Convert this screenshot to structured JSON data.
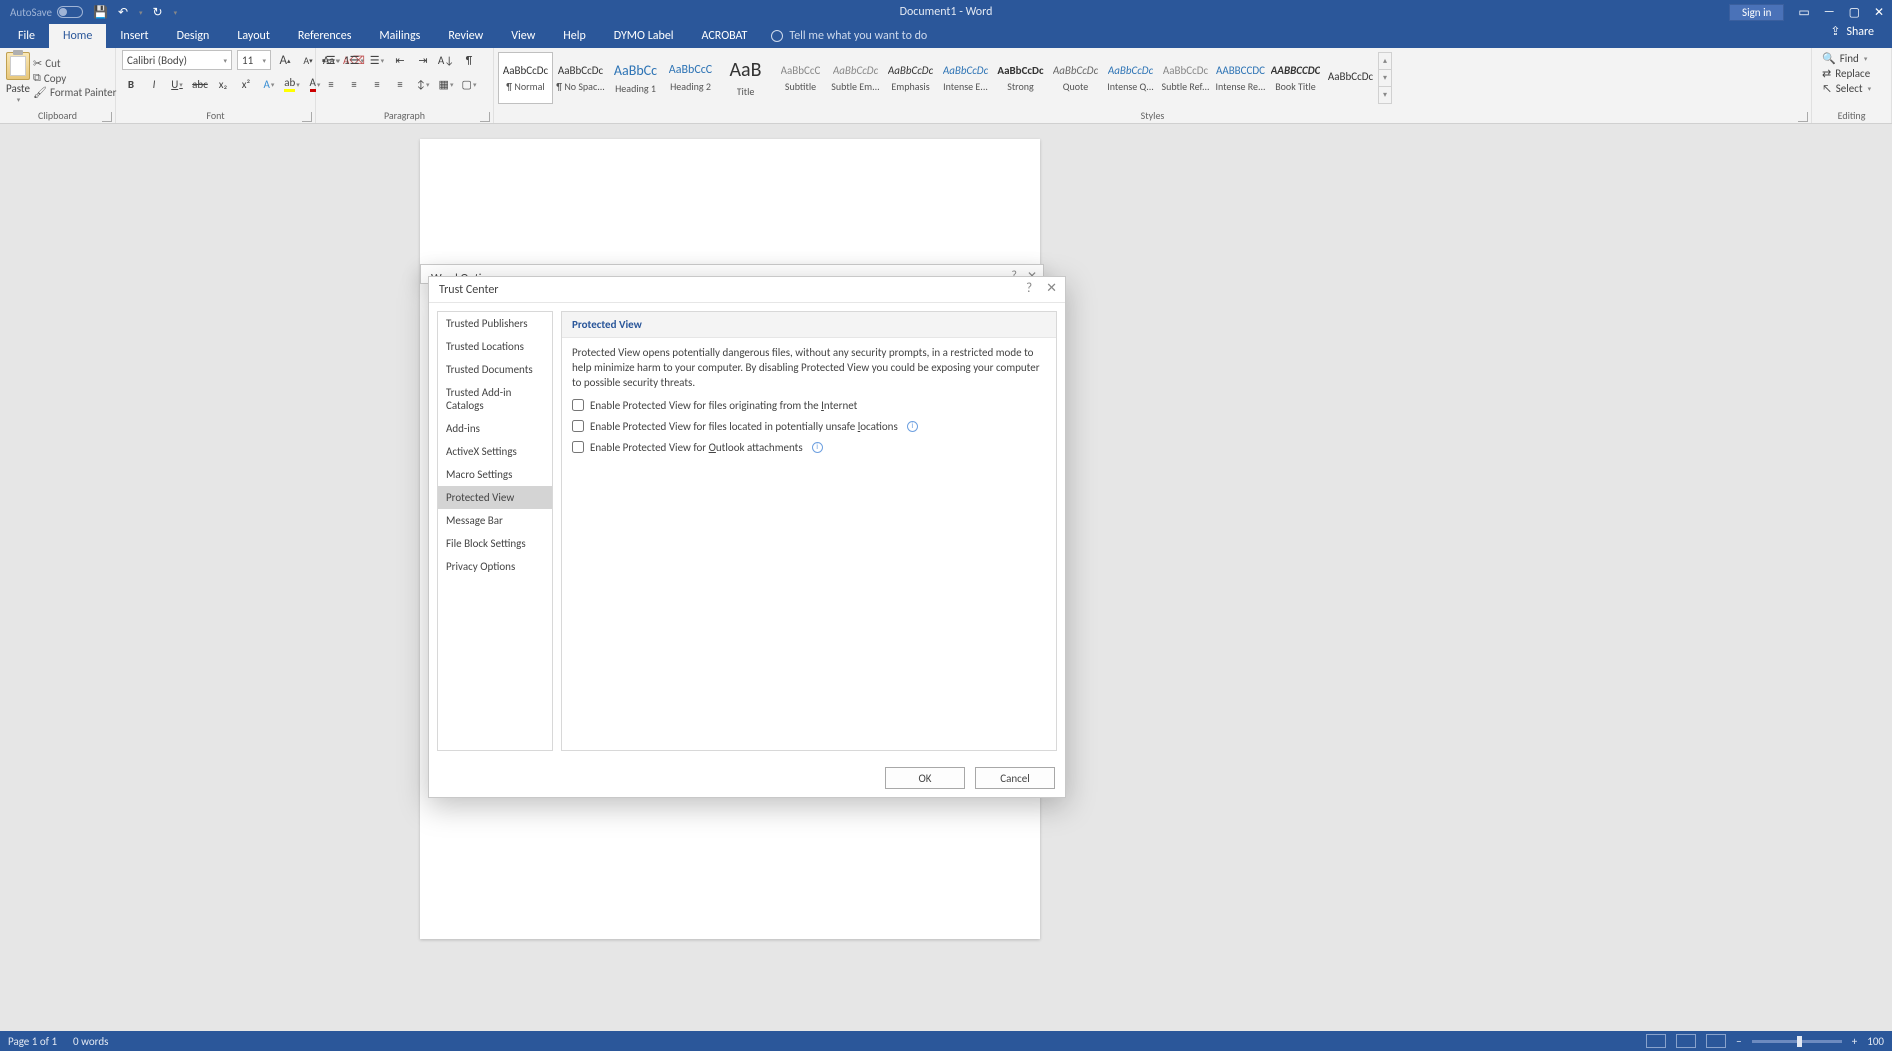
{
  "titlebar": {
    "autosave": "AutoSave",
    "doc_title": "Document1 - Word",
    "signin": "Sign in"
  },
  "tabs": {
    "file": "File",
    "home": "Home",
    "insert": "Insert",
    "design": "Design",
    "layout": "Layout",
    "references": "References",
    "mailings": "Mailings",
    "review": "Review",
    "view": "View",
    "help": "Help",
    "dymo": "DYMO Label",
    "acrobat": "ACROBAT",
    "tellme": "Tell me what you want to do",
    "share": "Share"
  },
  "ribbon": {
    "clipboard": {
      "label": "Clipboard",
      "paste": "Paste",
      "cut": "Cut",
      "copy": "Copy",
      "fp": "Format Painter"
    },
    "font": {
      "label": "Font",
      "name": "Calibri (Body)",
      "size": "11",
      "bold": "B",
      "italic": "I",
      "underline": "U",
      "strike": "abc",
      "sub": "x₂",
      "sup": "x²",
      "incA": "A",
      "decA": "A",
      "caseAa": "Aa",
      "clear": "A"
    },
    "paragraph": {
      "label": "Paragraph"
    },
    "styles": {
      "label": "Styles",
      "items": [
        {
          "preview": "AaBbCcDc",
          "name": "¶ Normal",
          "class": ""
        },
        {
          "preview": "AaBbCcDc",
          "name": "¶ No Spac...",
          "class": ""
        },
        {
          "preview": "AaBbCc",
          "name": "Heading 1",
          "class": "color:#2e74b5;font-size:14px"
        },
        {
          "preview": "AaBbCcC",
          "name": "Heading 2",
          "class": "color:#2e74b5;font-size:12px"
        },
        {
          "preview": "AaB",
          "name": "Title",
          "class": "font-size:20px"
        },
        {
          "preview": "AaBbCcC",
          "name": "Subtitle",
          "class": "color:#888"
        },
        {
          "preview": "AaBbCcDc",
          "name": "Subtle Em...",
          "class": "font-style:italic;color:#888"
        },
        {
          "preview": "AaBbCcDc",
          "name": "Emphasis",
          "class": "font-style:italic"
        },
        {
          "preview": "AaBbCcDc",
          "name": "Intense E...",
          "class": "font-style:italic;color:#2e74b5"
        },
        {
          "preview": "AaBbCcDc",
          "name": "Strong",
          "class": "font-weight:bold"
        },
        {
          "preview": "AaBbCcDc",
          "name": "Quote",
          "class": "font-style:italic;color:#666"
        },
        {
          "preview": "AaBbCcDc",
          "name": "Intense Q...",
          "class": "font-style:italic;color:#2e74b5"
        },
        {
          "preview": "AaBbCcDc",
          "name": "Subtle Ref...",
          "class": "color:#888"
        },
        {
          "preview": "AABBCCDC",
          "name": "Intense Re...",
          "class": "color:#2e74b5"
        },
        {
          "preview": "AABBCCDC",
          "name": "Book Title",
          "class": "font-weight:bold;font-style:italic"
        },
        {
          "preview": "AaBbCcDc",
          "name": "",
          "class": ""
        }
      ]
    },
    "editing": {
      "label": "Editing",
      "find": "Find",
      "replace": "Replace",
      "select": "Select"
    }
  },
  "wordoptions": {
    "title": "Word Options"
  },
  "trustcenter": {
    "title": "Trust Center",
    "nav": {
      "publishers": "Trusted Publishers",
      "locations": "Trusted Locations",
      "documents": "Trusted Documents",
      "catalogs": "Trusted Add-in Catalogs",
      "addins": "Add-ins",
      "activex": "ActiveX Settings",
      "macro": "Macro Settings",
      "protected": "Protected View",
      "msgbar": "Message Bar",
      "fileblock": "File Block Settings",
      "privacy": "Privacy Options"
    },
    "content": {
      "heading": "Protected View",
      "desc": "Protected View opens potentially dangerous files, without any security prompts, in a restricted mode to help minimize harm to your computer. By disabling Protected View you could be exposing your computer to possible security threats.",
      "cb1a": "Enable Protected View for files originating from the ",
      "cb1b": "I",
      "cb1c": "nternet",
      "cb2a": "Enable Protected View for files located in potentially unsafe ",
      "cb2b": "l",
      "cb2c": "ocations",
      "cb3a": "Enable Protected View for ",
      "cb3b": "O",
      "cb3c": "utlook attachments"
    },
    "ok": "OK",
    "cancel": "Cancel"
  },
  "statusbar": {
    "page": "Page 1 of 1",
    "words": "0 words",
    "zoom": "100",
    "minus": "−",
    "plus": "+"
  }
}
